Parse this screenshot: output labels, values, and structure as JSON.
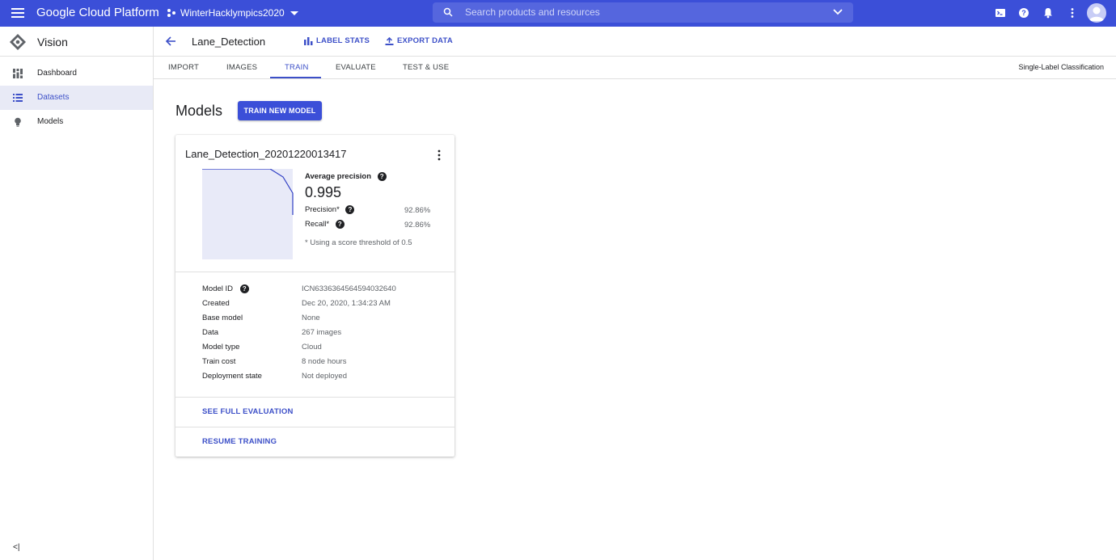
{
  "topbar": {
    "brand": "Google Cloud Platform",
    "project": "WinterHacklympics2020",
    "search_placeholder": "Search products and resources",
    "icons": [
      "menu-icon",
      "project-icon",
      "search-icon",
      "chevron-down-icon",
      "cloud-shell-icon",
      "help-icon",
      "notifications-icon",
      "more-vert-icon",
      "avatar"
    ]
  },
  "sidebar": {
    "title": "Vision",
    "items": [
      {
        "label": "Dashboard",
        "icon": "dashboard-icon",
        "active": false
      },
      {
        "label": "Datasets",
        "icon": "list-icon",
        "active": true
      },
      {
        "label": "Models",
        "icon": "lightbulb-icon",
        "active": false
      }
    ],
    "collapse": "<|"
  },
  "header": {
    "dataset_title": "Lane_Detection",
    "label_stats": "LABEL STATS",
    "export_data": "EXPORT DATA"
  },
  "tabs": {
    "items": [
      "IMPORT",
      "IMAGES",
      "TRAIN",
      "EVALUATE",
      "TEST & USE"
    ],
    "active": "TRAIN",
    "mode": "Single-Label Classification"
  },
  "main": {
    "title": "Models",
    "train_button": "TRAIN NEW MODEL"
  },
  "model_card": {
    "name": "Lane_Detection_20201220013417",
    "average_precision_label": "Average precision",
    "average_precision": "0.995",
    "precision_label": "Precision*",
    "precision": "92.86%",
    "recall_label": "Recall*",
    "recall": "92.86%",
    "note": "* Using a score threshold of 0.5",
    "details": [
      {
        "label": "Model ID",
        "value": "ICN6336364564594032640",
        "help": true
      },
      {
        "label": "Created",
        "value": "Dec 20, 2020, 1:34:23 AM"
      },
      {
        "label": "Base model",
        "value": "None"
      },
      {
        "label": "Data",
        "value": "267 images"
      },
      {
        "label": "Model type",
        "value": "Cloud"
      },
      {
        "label": "Train cost",
        "value": "8 node hours"
      },
      {
        "label": "Deployment state",
        "value": "Not deployed"
      }
    ],
    "see_full_evaluation": "SEE FULL EVALUATION",
    "resume_training": "RESUME TRAINING"
  },
  "colors": {
    "brand": "#3b4fd8",
    "accent": "#3d50c8",
    "chart_fill": "#e8eaf8",
    "chart_line": "#2f3fc4"
  }
}
